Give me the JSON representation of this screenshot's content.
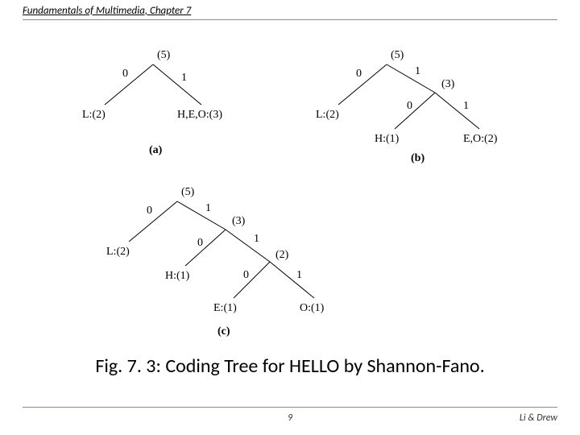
{
  "header": {
    "title": "Fundamentals of Multimedia, Chapter 7"
  },
  "caption": "Fig. 7. 3: Coding Tree for HELLO by Shannon-Fano.",
  "footer": {
    "page": "9",
    "authors": "Li & Drew"
  },
  "trees": {
    "a": {
      "label": "(a)",
      "root": {
        "count": "(5)"
      },
      "edges": {
        "left": "0",
        "right": "1"
      },
      "leaves": {
        "left": "L:(2)",
        "right": "H,E,O:(3)"
      }
    },
    "b": {
      "label": "(b)",
      "root": {
        "count": "(5)"
      },
      "edges": {
        "left": "0",
        "right": "1"
      },
      "leaves": {
        "left": "L:(2)"
      },
      "sub": {
        "count": "(3)",
        "edges": {
          "left": "0",
          "right": "1"
        },
        "leaves": {
          "left": "H:(1)",
          "right": "E,O:(2)"
        }
      }
    },
    "c": {
      "label": "(c)",
      "root": {
        "count": "(5)"
      },
      "edges": {
        "left": "0",
        "right": "1"
      },
      "leaves": {
        "left": "L:(2)"
      },
      "sub1": {
        "count": "(3)",
        "edges": {
          "left": "0",
          "right": "1"
        },
        "leaves": {
          "left": "H:(1)"
        }
      },
      "sub2": {
        "count": "(2)",
        "edges": {
          "left": "0",
          "right": "1"
        },
        "leaves": {
          "left": "E:(1)",
          "right": "O:(1)"
        }
      }
    }
  }
}
